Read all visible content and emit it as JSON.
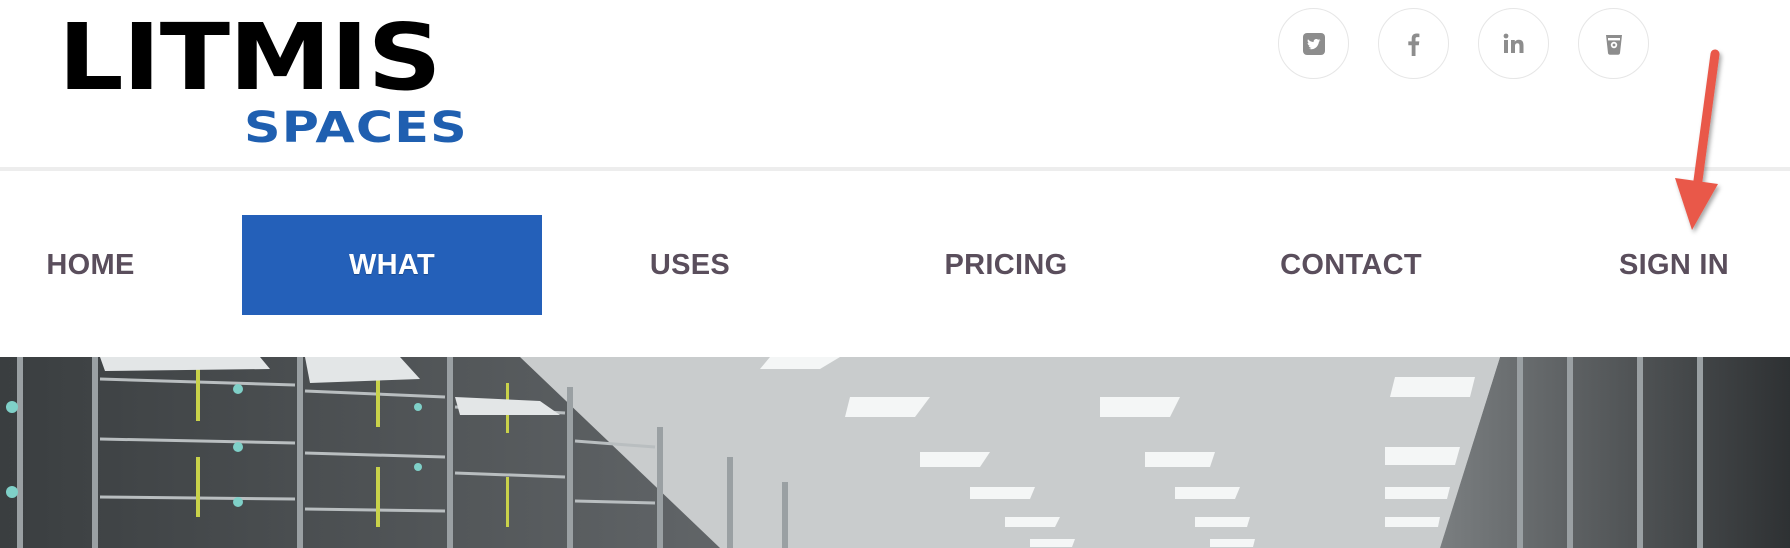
{
  "logo": {
    "main": "LITMIS",
    "sub": "SPACES"
  },
  "social": [
    {
      "icon": "twitter-icon"
    },
    {
      "icon": "facebook-icon"
    },
    {
      "icon": "linkedin-icon"
    },
    {
      "icon": "beer-glass-icon"
    }
  ],
  "nav": {
    "home": "HOME",
    "what": "WHAT",
    "uses": "USES",
    "pricing": "PRICING",
    "contact": "CONTACT",
    "sign_in": "SIGN IN"
  },
  "colors": {
    "brand_blue": "#1f5fb0",
    "nav_active_bg": "#2460b9",
    "nav_text": "#5a4e5c",
    "annotation_arrow": "#e9584a"
  },
  "hero": {
    "icon": "server-room-photo"
  }
}
